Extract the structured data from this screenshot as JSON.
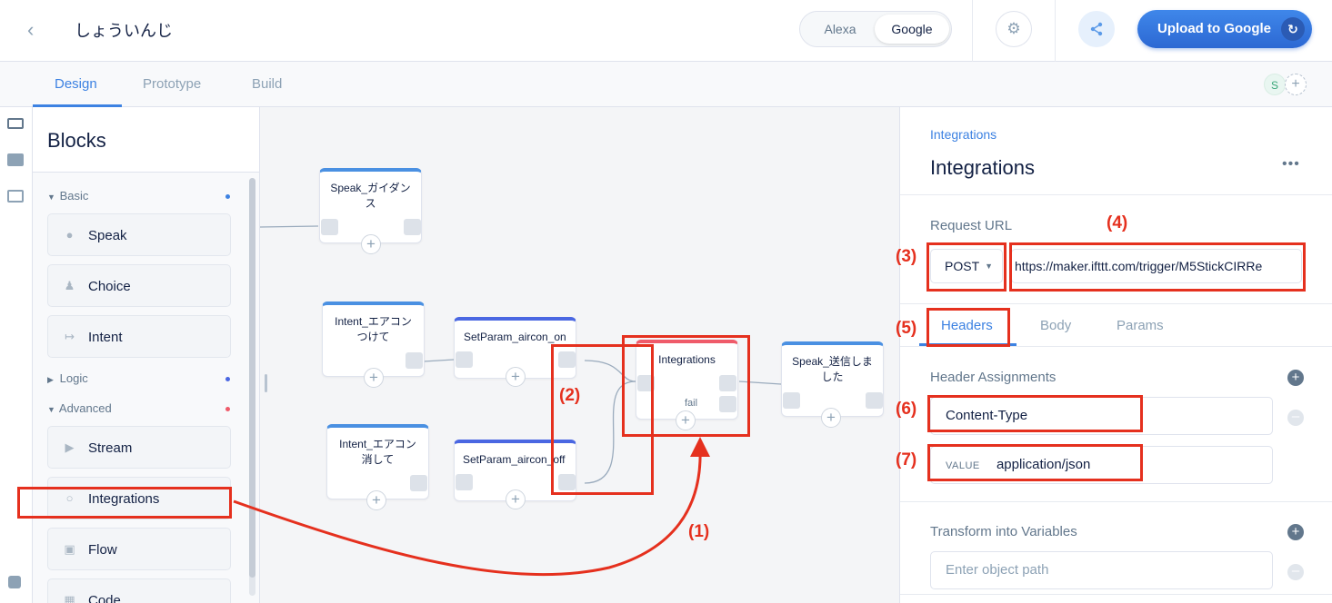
{
  "topbar": {
    "back_icon": "chevron-left-icon",
    "project_name": "しょういんじ",
    "platforms": [
      "Alexa",
      "Google"
    ],
    "active_platform": "Google",
    "settings_icon": "gear-icon",
    "share_icon": "share-icon",
    "upload_label": "Upload to Google",
    "upload_icon": "sync-icon",
    "accent_color": "#3d82e2"
  },
  "tabs": {
    "items": [
      "Design",
      "Prototype",
      "Build"
    ],
    "active": "Design",
    "avatar_initial": "S",
    "add_label": "+"
  },
  "blocks_panel": {
    "title": "Blocks",
    "categories": [
      {
        "label": "Basic",
        "expanded": true,
        "dot_color": "#3d82e2"
      },
      {
        "label": "Logic",
        "expanded": false,
        "dot_color": "#4a67e2"
      },
      {
        "label": "Advanced",
        "expanded": true,
        "dot_color": "#ef5b6a"
      }
    ],
    "basic_items": [
      {
        "label": "Speak",
        "icon": "speech-bubble-icon"
      },
      {
        "label": "Choice",
        "icon": "person-icon"
      },
      {
        "label": "Intent",
        "icon": "arrow-right-icon"
      }
    ],
    "advanced_items": [
      {
        "label": "Stream",
        "icon": "play-icon"
      },
      {
        "label": "Integrations",
        "icon": "globe-icon"
      },
      {
        "label": "Flow",
        "icon": "stack-icon"
      },
      {
        "label": "Code",
        "icon": "code-icon"
      }
    ]
  },
  "canvas": {
    "nodes": [
      {
        "title": "Speak_ガイダンス",
        "kind": "speak"
      },
      {
        "title": "Intent_エアコンつけて",
        "kind": "intent"
      },
      {
        "title": "SetParam_aircon_on",
        "kind": "set"
      },
      {
        "title": "Intent_エアコン消して",
        "kind": "intent"
      },
      {
        "title": "SetParam_aircon_off",
        "kind": "set"
      },
      {
        "title": "Integrations",
        "kind": "integrations",
        "fail_label": "fail"
      },
      {
        "title": "Speak_送信しました",
        "kind": "speak"
      }
    ],
    "plus_label": "+"
  },
  "right_panel": {
    "breadcrumb": "Integrations",
    "title": "Integrations",
    "more_label": "•••",
    "request_url_label": "Request URL",
    "method": "POST",
    "url": "https://maker.ifttt.com/trigger/M5StickCIRRe",
    "subtabs": [
      "Headers",
      "Body",
      "Params"
    ],
    "active_subtab": "Headers",
    "header_assignments_label": "Header Assignments",
    "header_key": "Content-Type",
    "value_label": "VALUE",
    "header_value": "application/json",
    "transform_label": "Transform into Variables",
    "transform_placeholder": "Enter object path"
  },
  "annotations": {
    "labels": [
      "(1)",
      "(2)",
      "(3)",
      "(4)",
      "(5)",
      "(6)",
      "(7)"
    ],
    "color": "#e5301e"
  }
}
